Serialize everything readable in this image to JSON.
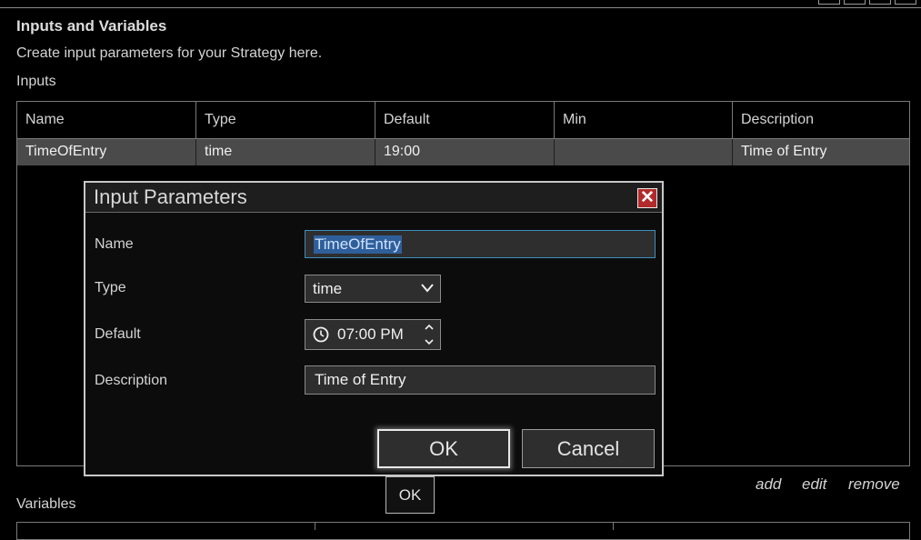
{
  "header": {
    "title": "Inputs and Variables",
    "subtitle": "Create input parameters for your Strategy here.",
    "inputs_label": "Inputs"
  },
  "inputs_table": {
    "columns": [
      "Name",
      "Type",
      "Default",
      "Min",
      "Description"
    ],
    "rows": [
      {
        "name": "TimeOfEntry",
        "type": "time",
        "default": "19:00",
        "min": "",
        "description": "Time of Entry"
      }
    ],
    "actions": {
      "add": "add",
      "edit": "edit",
      "remove": "remove"
    }
  },
  "variables_label": "Variables",
  "underlying_ok": "OK",
  "dialog": {
    "title": "Input Parameters",
    "close_glyph": "✕",
    "name_label": "Name",
    "name_value": "TimeOfEntry",
    "type_label": "Type",
    "type_value": "time",
    "default_label": "Default",
    "default_value": "07:00 PM",
    "description_label": "Description",
    "description_value": "Time of Entry",
    "ok_label": "OK",
    "cancel_label": "Cancel"
  },
  "icons": {
    "close": "close-icon",
    "dropdown": "chevron-down-icon",
    "clock": "clock-icon",
    "spinner": "spinner-arrows-icon"
  },
  "colors": {
    "background": "#000000",
    "selected_row": "#4a4a4a",
    "close_button": "#b22a2a",
    "focus_border": "#3c8fc0",
    "text_selection": "#2f5f9a"
  }
}
